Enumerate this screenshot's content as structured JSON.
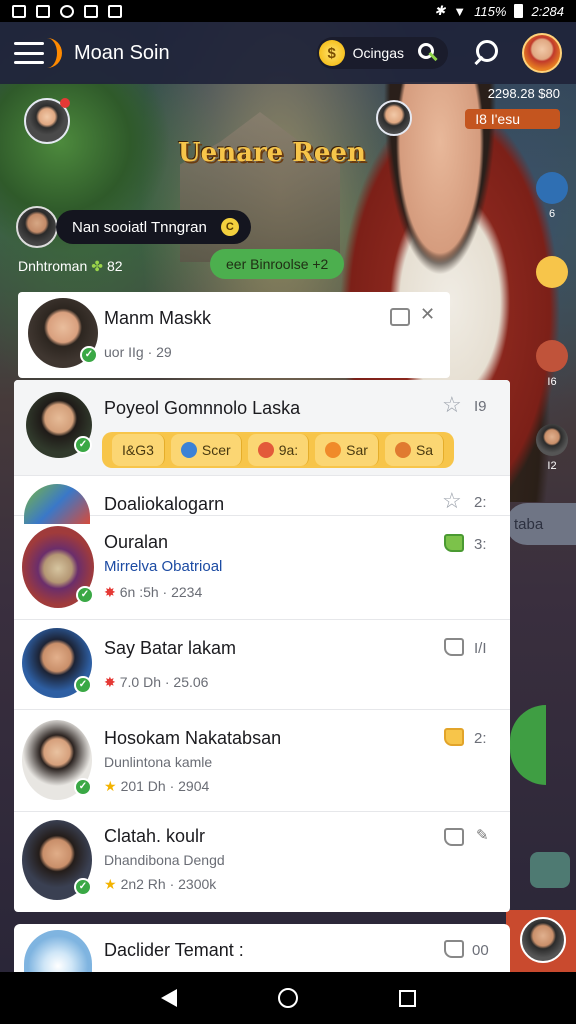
{
  "status_bar": {
    "time": "2:284",
    "battery": "115%"
  },
  "top_bar": {
    "title": "Moan Soin",
    "coin_label": "Ocingas",
    "coin_symbol": "$"
  },
  "game": {
    "title": "Uenare Reen",
    "stats_code": "2298.28 $80",
    "stats_badge": "I8 I'esu",
    "chat_text": "Nan sooiatl Tnngran",
    "chat_coin": "C",
    "online_label": "Dnhtroman",
    "online_count": "82",
    "green_pill": "eer Binroolse +2",
    "right_pill": "taba",
    "side_counts": [
      "6",
      "I6",
      "I2"
    ]
  },
  "friends": {
    "top": {
      "name": "Manm Maskk",
      "meta": "uor IIg · 29"
    },
    "chips_row": {
      "name": "Poyeol Gomnnolo Laska",
      "count": "I9",
      "chips": [
        "I&G3",
        "Scer",
        "9a:",
        "Sar",
        "Sa"
      ]
    },
    "rows": [
      {
        "name": "Doaliokalogarn",
        "count": "2:",
        "sub": "",
        "meta": ""
      },
      {
        "name": "Ouralan",
        "sub": "Mirrelva Obatrioal",
        "meta": "6n :5h · 2234",
        "count": "3:"
      },
      {
        "name": "Say Batar lakam",
        "sub": "",
        "meta": "7.0 Dh · 25.06",
        "count": "I/I"
      },
      {
        "name": "Hosokam Nakatabsan",
        "sub": "Dunlintona kamle",
        "meta": "201 Dh · 2904",
        "count": "2:"
      },
      {
        "name": "Clatah. koulr",
        "sub": "Dhandibona Dengd",
        "meta": "2n2 Rh · 2300k",
        "count": ""
      }
    ],
    "bottom": {
      "name": "Daclider Temant :",
      "count": "00"
    }
  },
  "colors": {
    "accent": "#f7c54a",
    "online": "#3aa845",
    "link": "#1c4ba3",
    "orange": "#ff8a00"
  }
}
